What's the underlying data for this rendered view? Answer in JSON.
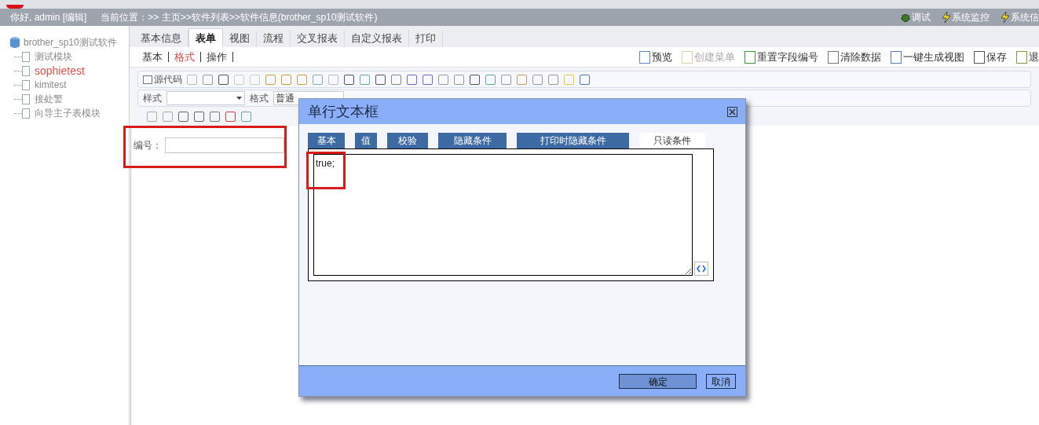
{
  "header": {
    "greeting": "你好, admin [编辑]",
    "breadcrumb": "当前位置：>> 主页>>软件列表>>软件信息(brother_sp10测试软件)",
    "links": [
      {
        "label": "调试",
        "kind": "bug"
      },
      {
        "label": "系统监控",
        "kind": "bolt"
      },
      {
        "label": "系统信",
        "kind": "bolt"
      }
    ]
  },
  "tree": {
    "root": "brother_sp10测试软件",
    "children": [
      {
        "label": "测试模块",
        "selected": false
      },
      {
        "label": "sophietest",
        "selected": true
      },
      {
        "label": "kimitest",
        "selected": false
      },
      {
        "label": "接处警",
        "selected": false
      },
      {
        "label": "向导主子表模块",
        "selected": false
      }
    ]
  },
  "tabs": [
    {
      "label": "基本信息",
      "selected": false
    },
    {
      "label": "表单",
      "selected": true
    },
    {
      "label": "视图",
      "selected": false
    },
    {
      "label": "流程",
      "selected": false
    },
    {
      "label": "交叉报表",
      "selected": false
    },
    {
      "label": "自定义报表",
      "selected": false
    },
    {
      "label": "打印",
      "selected": false
    }
  ],
  "subtabs": [
    {
      "label": "基本",
      "selected": false
    },
    {
      "label": "格式",
      "selected": true
    },
    {
      "label": "操作",
      "selected": false
    }
  ],
  "actions": [
    {
      "label": "预览",
      "disabled": false
    },
    {
      "label": "创建菜单",
      "disabled": true
    },
    {
      "label": "重置字段编号",
      "disabled": false
    },
    {
      "label": "清除数据",
      "disabled": false
    },
    {
      "label": "一键生成视图",
      "disabled": false
    },
    {
      "label": "保存",
      "disabled": false
    },
    {
      "label": "退",
      "disabled": false
    }
  ],
  "toolbar": {
    "source_label": "源代码",
    "style_label": "样式",
    "format_label": "格式",
    "format_value": "普通"
  },
  "form": {
    "field_label": "编号："
  },
  "dialog": {
    "title": "单行文本框",
    "tabs": [
      {
        "label": "基本",
        "selected": false
      },
      {
        "label": "值",
        "selected": false
      },
      {
        "label": "校验",
        "selected": false
      },
      {
        "label": "隐藏条件",
        "selected": false
      },
      {
        "label": "打印时隐藏条件",
        "selected": false
      },
      {
        "label": "只读条件",
        "selected": true
      }
    ],
    "code": "true;",
    "buttons": [
      {
        "label": "确定",
        "kind": "primary"
      },
      {
        "label": "取消",
        "kind": "secondary"
      }
    ]
  }
}
